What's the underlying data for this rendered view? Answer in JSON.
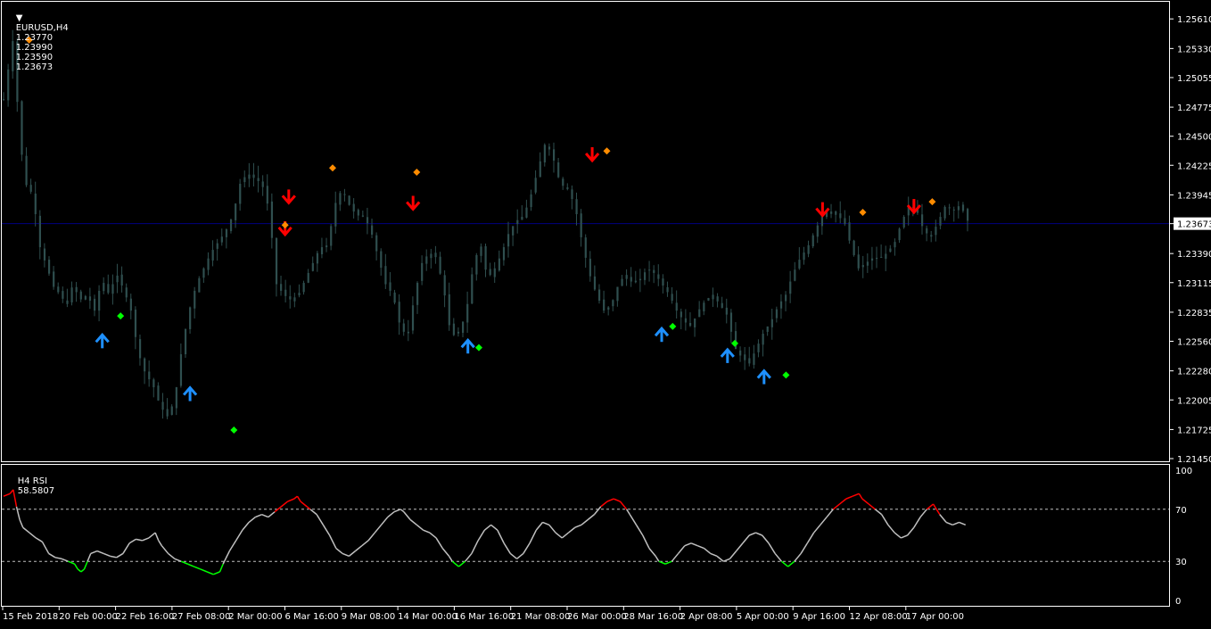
{
  "header": {
    "symbol": "EURUSD,H4",
    "open": "1.23770",
    "high": "1.23990",
    "low": "1.23590",
    "close": "1.23673"
  },
  "rsi_header": {
    "label": "H4 RSI",
    "value": "58.5807"
  },
  "colors": {
    "background": "#000000",
    "candle": "#2f4f4f",
    "grid_border": "#ffffff",
    "current_price_line": "#000080",
    "arrow_up": "#1e90ff",
    "arrow_down": "#ff0000",
    "dot_high": "#ff8c00",
    "dot_low": "#00ff00",
    "rsi_line": "#c0c0c0",
    "rsi_overbought": "#ff0000",
    "rsi_oversold": "#00ff00"
  },
  "chart_data": {
    "type": "candlestick",
    "symbol": "EURUSD",
    "timeframe": "H4",
    "price_ticks": [
      "1.25610",
      "1.25330",
      "1.25055",
      "1.24775",
      "1.24500",
      "1.24225",
      "1.23945",
      "1.23673",
      "1.23390",
      "1.23115",
      "1.22835",
      "1.22560",
      "1.22280",
      "1.22005",
      "1.21725",
      "1.21450"
    ],
    "current_price": "1.23673",
    "ylim": [
      1.2145,
      1.2562
    ],
    "x_ticks": [
      "15 Feb 2018",
      "20 Feb 00:00",
      "22 Feb 16:00",
      "27 Feb 08:00",
      "2 Mar 00:00",
      "6 Mar 16:00",
      "9 Mar 08:00",
      "14 Mar 00:00",
      "16 Mar 16:00",
      "21 Mar 08:00",
      "26 Mar 00:00",
      "28 Mar 16:00",
      "2 Apr 08:00",
      "5 Apr 00:00",
      "9 Apr 16:00",
      "12 Apr 08:00",
      "17 Apr 00:00"
    ],
    "bar_count": 220,
    "close_series": [
      [
        0,
        1.2485
      ],
      [
        4,
        1.253
      ],
      [
        6,
        1.255
      ],
      [
        8,
        1.246
      ],
      [
        12,
        1.2405
      ],
      [
        16,
        1.2395
      ],
      [
        20,
        1.2345
      ],
      [
        24,
        1.2325
      ],
      [
        28,
        1.2305
      ],
      [
        32,
        1.23
      ],
      [
        34,
        1.2285
      ],
      [
        38,
        1.231
      ],
      [
        42,
        1.2295
      ],
      [
        46,
        1.23
      ],
      [
        50,
        1.2285
      ],
      [
        54,
        1.2315
      ],
      [
        58,
        1.23
      ],
      [
        62,
        1.232
      ],
      [
        66,
        1.2305
      ],
      [
        70,
        1.2285
      ],
      [
        74,
        1.2245
      ],
      [
        78,
        1.2225
      ],
      [
        82,
        1.2215
      ],
      [
        86,
        1.2195
      ],
      [
        90,
        1.2185
      ],
      [
        94,
        1.22
      ],
      [
        98,
        1.225
      ],
      [
        102,
        1.2285
      ],
      [
        106,
        1.231
      ],
      [
        110,
        1.2325
      ],
      [
        114,
        1.234
      ],
      [
        118,
        1.235
      ],
      [
        122,
        1.236
      ],
      [
        126,
        1.2375
      ],
      [
        130,
        1.2405
      ],
      [
        134,
        1.2415
      ],
      [
        138,
        1.241
      ],
      [
        142,
        1.2405
      ],
      [
        146,
        1.238
      ],
      [
        150,
        1.231
      ],
      [
        154,
        1.23
      ],
      [
        158,
        1.2295
      ],
      [
        162,
        1.23
      ],
      [
        166,
        1.2315
      ],
      [
        170,
        1.233
      ],
      [
        174,
        1.2345
      ],
      [
        178,
        1.2345
      ],
      [
        182,
        1.2385
      ],
      [
        186,
        1.24
      ],
      [
        190,
        1.2385
      ],
      [
        194,
        1.2375
      ],
      [
        198,
        1.2375
      ],
      [
        202,
        1.236
      ],
      [
        206,
        1.2335
      ],
      [
        210,
        1.231
      ],
      [
        214,
        1.23
      ],
      [
        218,
        1.227
      ],
      [
        222,
        1.226
      ],
      [
        226,
        1.23
      ],
      [
        230,
        1.233
      ],
      [
        234,
        1.234
      ],
      [
        238,
        1.2335
      ],
      [
        242,
        1.2305
      ],
      [
        246,
        1.226
      ],
      [
        250,
        1.2265
      ],
      [
        254,
        1.228
      ],
      [
        258,
        1.2325
      ],
      [
        262,
        1.235
      ],
      [
        266,
        1.2315
      ],
      [
        270,
        1.2325
      ],
      [
        274,
        1.234
      ],
      [
        278,
        1.236
      ],
      [
        282,
        1.237
      ],
      [
        286,
        1.2375
      ],
      [
        290,
        1.2395
      ],
      [
        294,
        1.242
      ],
      [
        298,
        1.2445
      ],
      [
        302,
        1.243
      ],
      [
        306,
        1.2405
      ],
      [
        310,
        1.24
      ],
      [
        314,
        1.2385
      ],
      [
        318,
        1.235
      ],
      [
        322,
        1.232
      ],
      [
        326,
        1.23
      ],
      [
        330,
        1.2285
      ],
      [
        334,
        1.229
      ],
      [
        338,
        1.231
      ],
      [
        342,
        1.232
      ],
      [
        346,
        1.231
      ],
      [
        350,
        1.2315
      ],
      [
        354,
        1.2325
      ],
      [
        358,
        1.232
      ],
      [
        362,
        1.231
      ],
      [
        366,
        1.23
      ],
      [
        370,
        1.2285
      ],
      [
        374,
        1.2275
      ],
      [
        378,
        1.227
      ],
      [
        382,
        1.2285
      ],
      [
        386,
        1.2295
      ],
      [
        390,
        1.23
      ],
      [
        394,
        1.229
      ],
      [
        398,
        1.228
      ],
      [
        402,
        1.225
      ],
      [
        406,
        1.224
      ],
      [
        410,
        1.2235
      ],
      [
        414,
        1.225
      ],
      [
        418,
        1.2265
      ],
      [
        422,
        1.2275
      ],
      [
        426,
        1.229
      ],
      [
        430,
        1.23
      ],
      [
        434,
        1.232
      ],
      [
        438,
        1.2335
      ],
      [
        442,
        1.2345
      ],
      [
        446,
        1.236
      ],
      [
        450,
        1.2375
      ],
      [
        454,
        1.238
      ],
      [
        458,
        1.2375
      ],
      [
        462,
        1.237
      ],
      [
        466,
        1.2345
      ],
      [
        470,
        1.2325
      ],
      [
        474,
        1.233
      ],
      [
        478,
        1.2335
      ],
      [
        482,
        1.2335
      ],
      [
        486,
        1.234
      ],
      [
        490,
        1.235
      ],
      [
        494,
        1.237
      ],
      [
        498,
        1.2385
      ],
      [
        502,
        1.238
      ],
      [
        506,
        1.236
      ],
      [
        510,
        1.2355
      ],
      [
        514,
        1.237
      ],
      [
        518,
        1.2385
      ],
      [
        522,
        1.238
      ],
      [
        526,
        1.2385
      ],
      [
        530,
        1.237
      ]
    ],
    "signals": {
      "up_arrows": [
        {
          "bar": 27,
          "price": 1.2257
        },
        {
          "bar": 51,
          "price": 1.2207
        },
        {
          "bar": 127,
          "price": 1.2252
        },
        {
          "bar": 180,
          "price": 1.2263
        },
        {
          "bar": 198,
          "price": 1.2243
        },
        {
          "bar": 208,
          "price": 1.2223
        }
      ],
      "down_arrows": [
        {
          "bar": 77,
          "price": 1.2362
        },
        {
          "bar": 78,
          "price": 1.2392
        },
        {
          "bar": 112,
          "price": 1.2386
        },
        {
          "bar": 161,
          "price": 1.2432
        },
        {
          "bar": 224,
          "price": 1.238
        },
        {
          "bar": 249,
          "price": 1.2383
        }
      ],
      "high_dots": [
        {
          "bar": 7,
          "price": 1.2541
        },
        {
          "bar": 77,
          "price": 1.2366
        },
        {
          "bar": 90,
          "price": 1.242
        },
        {
          "bar": 113,
          "price": 1.2416
        },
        {
          "bar": 165,
          "price": 1.2436
        },
        {
          "bar": 235,
          "price": 1.2378
        },
        {
          "bar": 254,
          "price": 1.2388
        }
      ],
      "low_dots": [
        {
          "bar": 32,
          "price": 1.228
        },
        {
          "bar": 63,
          "price": 1.2172
        },
        {
          "bar": 130,
          "price": 1.225
        },
        {
          "bar": 183,
          "price": 1.227
        },
        {
          "bar": 200,
          "price": 1.2254
        },
        {
          "bar": 214,
          "price": 1.2224
        }
      ]
    },
    "rsi": {
      "name": "H4 RSI",
      "current": 58.5807,
      "levels": [
        30,
        70
      ],
      "ticks": [
        "100",
        "70",
        "30",
        "0"
      ],
      "ylim": [
        0,
        100
      ],
      "series": [
        [
          0,
          80
        ],
        [
          4,
          82
        ],
        [
          6,
          85
        ],
        [
          8,
          72
        ],
        [
          10,
          62
        ],
        [
          12,
          56
        ],
        [
          16,
          52
        ],
        [
          20,
          48
        ],
        [
          24,
          45
        ],
        [
          28,
          36
        ],
        [
          32,
          33
        ],
        [
          36,
          32
        ],
        [
          40,
          30
        ],
        [
          44,
          28
        ],
        [
          46,
          24
        ],
        [
          48,
          22
        ],
        [
          50,
          24
        ],
        [
          52,
          30
        ],
        [
          54,
          36
        ],
        [
          58,
          38
        ],
        [
          62,
          36
        ],
        [
          66,
          34
        ],
        [
          70,
          33
        ],
        [
          74,
          36
        ],
        [
          78,
          44
        ],
        [
          82,
          47
        ],
        [
          86,
          46
        ],
        [
          90,
          48
        ],
        [
          94,
          52
        ],
        [
          96,
          46
        ],
        [
          98,
          42
        ],
        [
          102,
          36
        ],
        [
          106,
          32
        ],
        [
          110,
          30
        ],
        [
          114,
          28
        ],
        [
          118,
          26
        ],
        [
          122,
          24
        ],
        [
          126,
          22
        ],
        [
          130,
          20
        ],
        [
          134,
          22
        ],
        [
          136,
          28
        ],
        [
          140,
          38
        ],
        [
          144,
          46
        ],
        [
          148,
          54
        ],
        [
          152,
          60
        ],
        [
          156,
          64
        ],
        [
          160,
          66
        ],
        [
          164,
          64
        ],
        [
          168,
          68
        ],
        [
          172,
          72
        ],
        [
          176,
          76
        ],
        [
          180,
          78
        ],
        [
          182,
          80
        ],
        [
          184,
          76
        ],
        [
          188,
          72
        ],
        [
          190,
          70
        ],
        [
          194,
          66
        ],
        [
          198,
          58
        ],
        [
          202,
          50
        ],
        [
          206,
          40
        ],
        [
          210,
          36
        ],
        [
          214,
          34
        ],
        [
          218,
          38
        ],
        [
          222,
          42
        ],
        [
          226,
          46
        ],
        [
          230,
          52
        ],
        [
          234,
          58
        ],
        [
          238,
          64
        ],
        [
          242,
          68
        ],
        [
          246,
          70
        ],
        [
          248,
          68
        ],
        [
          252,
          62
        ],
        [
          256,
          58
        ],
        [
          260,
          54
        ],
        [
          264,
          52
        ],
        [
          268,
          48
        ],
        [
          272,
          40
        ],
        [
          276,
          34
        ],
        [
          278,
          30
        ],
        [
          282,
          26
        ],
        [
          286,
          30
        ],
        [
          290,
          36
        ],
        [
          294,
          46
        ],
        [
          298,
          54
        ],
        [
          302,
          58
        ],
        [
          306,
          54
        ],
        [
          310,
          44
        ],
        [
          314,
          36
        ],
        [
          318,
          32
        ],
        [
          322,
          36
        ],
        [
          326,
          44
        ],
        [
          330,
          54
        ],
        [
          334,
          60
        ],
        [
          338,
          58
        ],
        [
          342,
          52
        ],
        [
          346,
          48
        ],
        [
          350,
          52
        ],
        [
          354,
          56
        ],
        [
          358,
          58
        ],
        [
          362,
          62
        ],
        [
          366,
          66
        ],
        [
          370,
          72
        ],
        [
          374,
          76
        ],
        [
          378,
          78
        ],
        [
          382,
          76
        ],
        [
          386,
          70
        ],
        [
          388,
          66
        ],
        [
          392,
          58
        ],
        [
          396,
          50
        ],
        [
          400,
          40
        ],
        [
          404,
          34
        ],
        [
          406,
          30
        ],
        [
          410,
          28
        ],
        [
          414,
          30
        ],
        [
          418,
          36
        ],
        [
          422,
          42
        ],
        [
          426,
          44
        ],
        [
          430,
          42
        ],
        [
          434,
          40
        ],
        [
          438,
          36
        ],
        [
          442,
          34
        ],
        [
          446,
          30
        ],
        [
          450,
          32
        ],
        [
          454,
          38
        ],
        [
          458,
          44
        ],
        [
          462,
          50
        ],
        [
          466,
          52
        ],
        [
          470,
          50
        ],
        [
          474,
          44
        ],
        [
          478,
          36
        ],
        [
          482,
          30
        ],
        [
          486,
          26
        ],
        [
          490,
          30
        ],
        [
          494,
          36
        ],
        [
          498,
          44
        ],
        [
          502,
          52
        ],
        [
          506,
          58
        ],
        [
          510,
          64
        ],
        [
          514,
          70
        ],
        [
          518,
          74
        ],
        [
          522,
          78
        ],
        [
          526,
          80
        ],
        [
          530,
          82
        ],
        [
          532,
          78
        ],
        [
          536,
          74
        ],
        [
          540,
          70
        ],
        [
          544,
          66
        ],
        [
          548,
          58
        ],
        [
          552,
          52
        ],
        [
          556,
          48
        ],
        [
          560,
          50
        ],
        [
          564,
          56
        ],
        [
          568,
          64
        ],
        [
          572,
          70
        ],
        [
          576,
          74
        ],
        [
          580,
          66
        ],
        [
          584,
          60
        ],
        [
          588,
          58
        ],
        [
          592,
          60
        ],
        [
          596,
          58
        ]
      ]
    }
  }
}
